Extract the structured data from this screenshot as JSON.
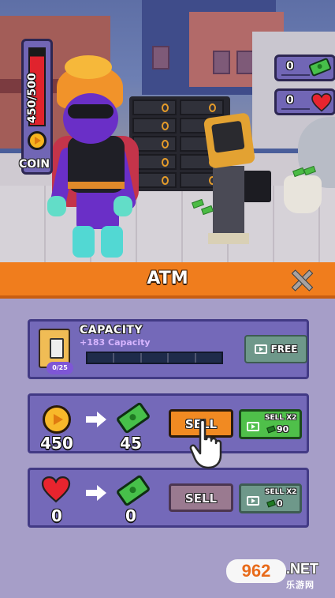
{
  "hud": {
    "health_text": "450/500",
    "health_fraction": 0.9,
    "coin_label": "COIN",
    "money_count": "0",
    "heart_count": "0"
  },
  "atm": {
    "title": "ATM",
    "close_label": "X",
    "capacity": {
      "title": "CAPACITY",
      "subtitle": "+183 Capacity",
      "badge": "0/25",
      "fill_fraction": 0.0,
      "free_label": "FREE"
    },
    "coin_row": {
      "from_value": "450",
      "to_value": "45",
      "sell_label": "SELL",
      "x2_label": "SELL X2",
      "x2_amount": "90"
    },
    "heart_row": {
      "from_value": "0",
      "to_value": "0",
      "sell_label": "SELL",
      "x2_label": "SELL X2",
      "x2_amount": "0"
    }
  },
  "watermark": {
    "logo": "962",
    "suffix": ".NET",
    "sub": "乐游网"
  },
  "colors": {
    "header_orange": "#f07d1d",
    "panel_purple": "#a69ec8",
    "card_purple": "#7469b9",
    "sell_orange": "#f18a22",
    "x2_green": "#4fc04a",
    "disabled_teal": "#6e988a",
    "health_red": "#e0232d"
  },
  "icons": [
    "coin-icon",
    "money-icon",
    "heart-icon",
    "atm-icon",
    "video-icon",
    "arrow-right-icon",
    "close-icon",
    "tap-hand-icon"
  ]
}
